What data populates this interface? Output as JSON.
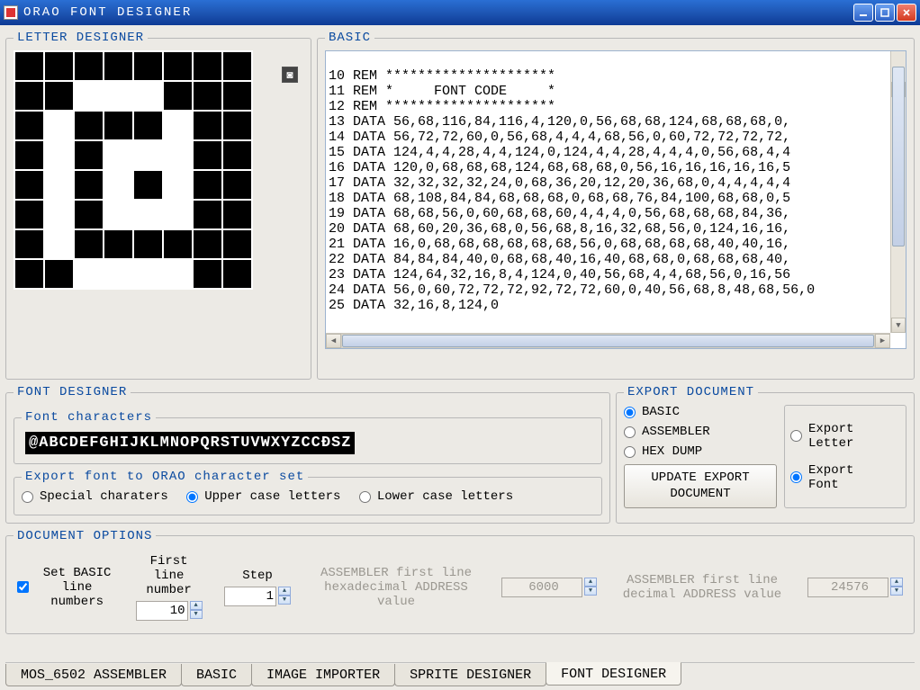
{
  "window": {
    "title": "ORAO  FONT  DESIGNER"
  },
  "letter_designer": {
    "legend": "LETTER DESIGNER",
    "grid": [
      [
        0,
        0,
        0,
        0,
        0,
        0,
        0,
        0
      ],
      [
        0,
        0,
        1,
        1,
        1,
        0,
        0,
        0
      ],
      [
        0,
        1,
        0,
        0,
        0,
        1,
        0,
        0
      ],
      [
        0,
        1,
        0,
        1,
        1,
        1,
        0,
        0
      ],
      [
        0,
        1,
        0,
        1,
        0,
        1,
        0,
        0
      ],
      [
        0,
        1,
        0,
        1,
        1,
        1,
        0,
        0
      ],
      [
        0,
        1,
        0,
        0,
        0,
        0,
        0,
        0
      ],
      [
        0,
        0,
        1,
        1,
        1,
        1,
        0,
        0
      ]
    ]
  },
  "basic": {
    "legend": "BASIC",
    "lines": [
      "10 REM *********************",
      "11 REM *     FONT CODE     *",
      "12 REM *********************",
      "13 DATA 56,68,116,84,116,4,120,0,56,68,68,124,68,68,68,0,",
      "14 DATA 56,72,72,60,0,56,68,4,4,4,68,56,0,60,72,72,72,72,",
      "15 DATA 124,4,4,28,4,4,124,0,124,4,4,28,4,4,4,0,56,68,4,4",
      "16 DATA 120,0,68,68,68,124,68,68,68,0,56,16,16,16,16,16,5",
      "17 DATA 32,32,32,32,24,0,68,36,20,12,20,36,68,0,4,4,4,4,4",
      "18 DATA 68,108,84,84,68,68,68,0,68,68,76,84,100,68,68,0,5",
      "19 DATA 68,68,56,0,60,68,68,60,4,4,4,0,56,68,68,68,84,36,",
      "20 DATA 68,60,20,36,68,0,56,68,8,16,32,68,56,0,124,16,16,",
      "21 DATA 16,0,68,68,68,68,68,68,56,0,68,68,68,68,40,40,16,",
      "22 DATA 84,84,84,40,0,68,68,40,16,40,68,68,0,68,68,68,40,",
      "23 DATA 124,64,32,16,8,4,124,0,40,56,68,4,4,68,56,0,16,56",
      "24 DATA 56,0,60,72,72,72,92,72,72,60,0,40,56,68,8,48,68,56,0",
      "25 DATA 32,16,8,124,0"
    ]
  },
  "font_designer": {
    "legend": "FONT DESIGNER",
    "chars_legend": "Font characters",
    "chars_strip": "@ABCDEFGHIJKLMNOPQRSTUVWXYZCCĐSZ",
    "export_legend": "Export font to ORAO character set",
    "radios": {
      "special": "Special charaters",
      "upper": "Upper case letters",
      "lower": "Lower case letters",
      "selected": "upper"
    }
  },
  "export_doc": {
    "legend": "EXPORT DOCUMENT",
    "formats": {
      "basic": "BASIC",
      "assembler": "ASSEMBLER",
      "hex": "HEX DUMP",
      "selected": "basic"
    },
    "button": "UPDATE EXPORT DOCUMENT",
    "scope": {
      "letter": "Export Letter",
      "font": "Export Font",
      "selected": "font"
    }
  },
  "doc_options": {
    "legend": "DOCUMENT OPTIONS",
    "set_line_numbers_label": "Set BASIC line numbers",
    "set_line_numbers_checked": true,
    "first_line_label": "First line number",
    "first_line_value": "10",
    "step_label": "Step",
    "step_value": "1",
    "asm_hex_label": "ASSEMBLER first line hexadecimal ADDRESS value",
    "asm_hex_value": "6000",
    "asm_dec_label": "ASSEMBLER first line decimal ADDRESS value",
    "asm_dec_value": "24576"
  },
  "tabs": {
    "items": [
      "MOS_6502 ASSEMBLER",
      "BASIC",
      "IMAGE IMPORTER",
      "SPRITE DESIGNER",
      "FONT DESIGNER"
    ],
    "active": 4
  }
}
